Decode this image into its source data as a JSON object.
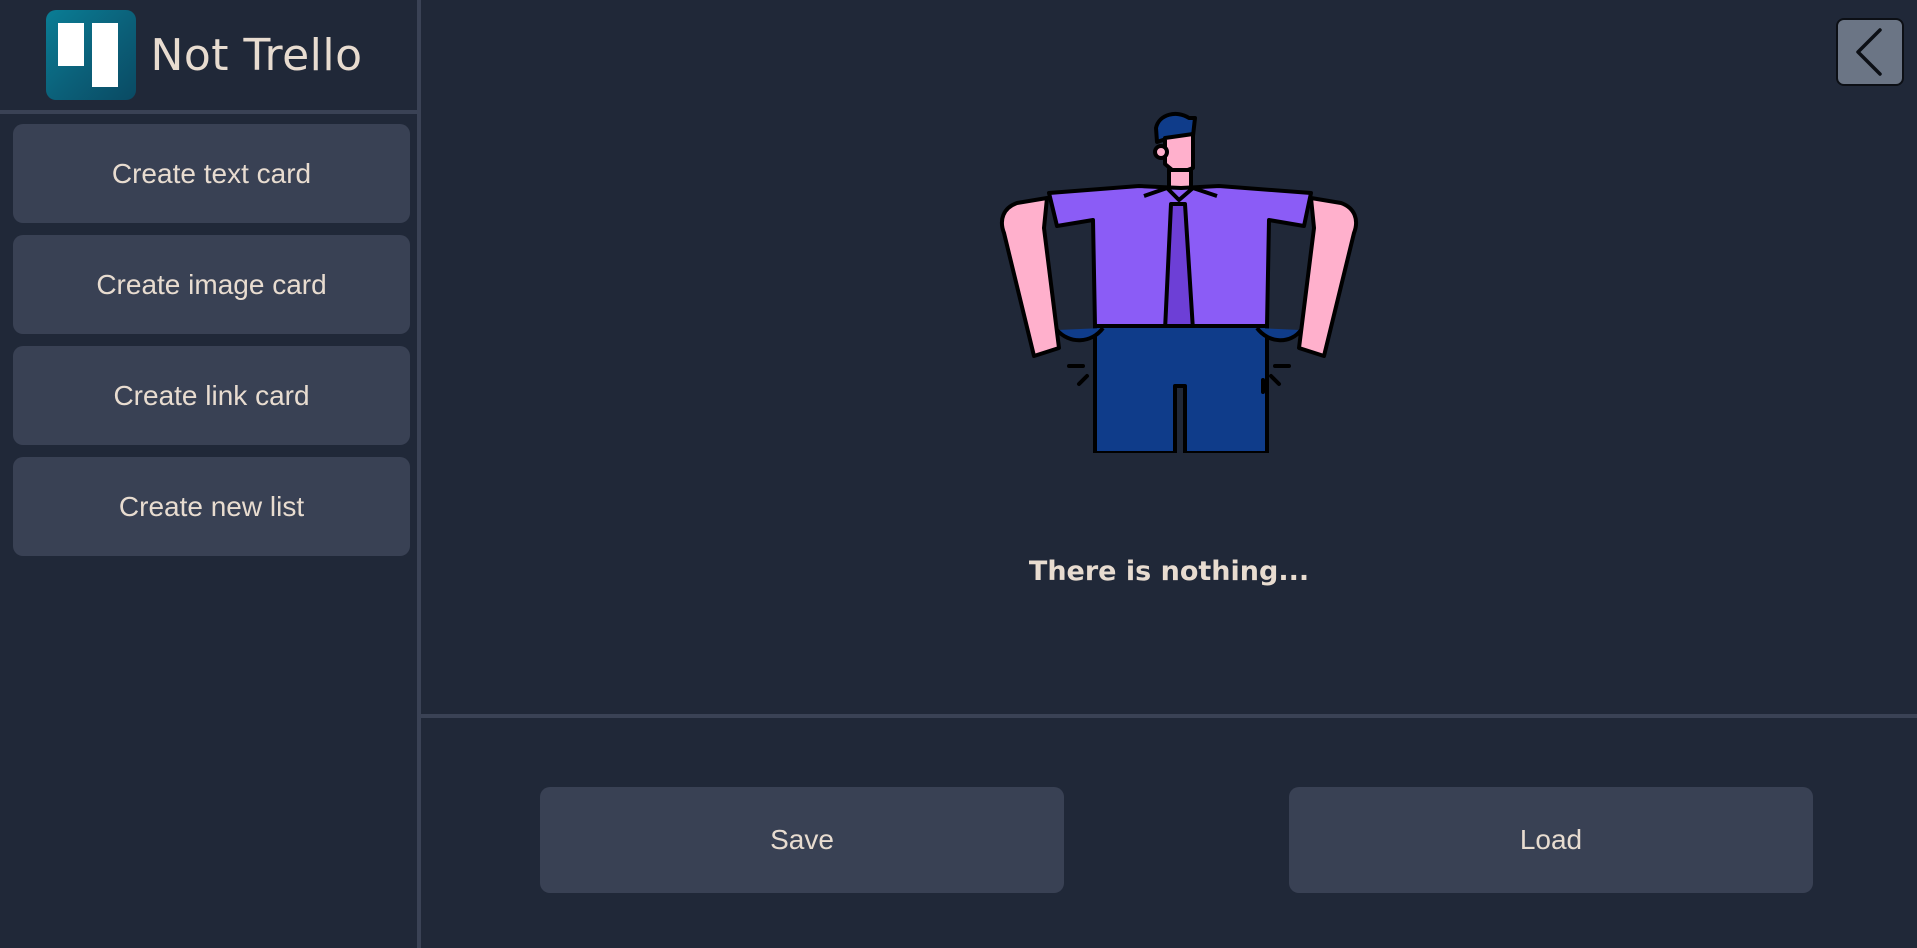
{
  "app": {
    "title": "Not Trello"
  },
  "sidebar": {
    "items": [
      {
        "label": "Create text card"
      },
      {
        "label": "Create image card"
      },
      {
        "label": "Create link card"
      },
      {
        "label": "Create new list"
      }
    ]
  },
  "main": {
    "empty_message": "There is nothing...",
    "back_icon": "chevron-left-icon"
  },
  "footer": {
    "save_label": "Save",
    "load_label": "Load"
  },
  "colors": {
    "background": "#202838",
    "panel": "#394154",
    "divider": "#3a4255",
    "text": "#e8dcd0",
    "logo": "#0a6f8a",
    "shirt": "#8b5cf6",
    "pants": "#0f3c8a",
    "skin": "#ffb0cc"
  }
}
